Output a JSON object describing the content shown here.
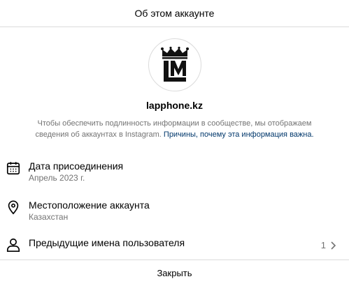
{
  "dialog": {
    "title": "Об этом аккаунте",
    "avatar_icon": "lm-crown-logo",
    "username": "lapphone.kz",
    "description": "Чтобы обеспечить подлинность информации в сообществе, мы отображаем сведения об аккаунтах в Instagram.",
    "description_link": "Причины, почему эта информация важна.",
    "items": [
      {
        "icon": "calendar-icon",
        "title": "Дата присоединения",
        "subtitle": "Апрель 2023 г."
      },
      {
        "icon": "location-pin-icon",
        "title": "Местоположение аккаунта",
        "subtitle": "Казахстан"
      },
      {
        "icon": "user-icon",
        "title": "Предыдущие имена пользователя",
        "count": "1"
      }
    ],
    "close_label": "Закрыть"
  }
}
